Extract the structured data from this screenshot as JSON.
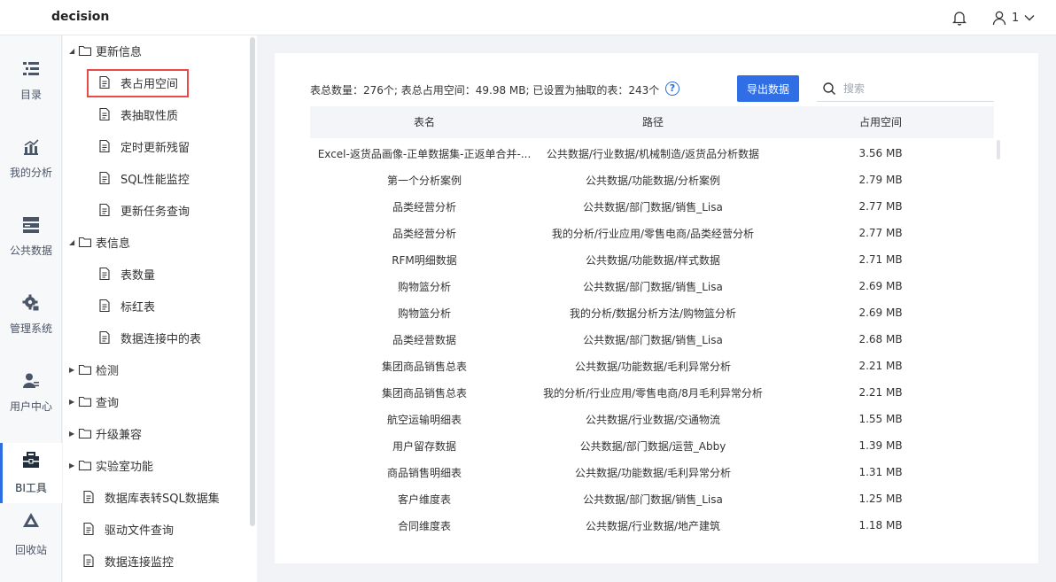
{
  "app": {
    "title": "decision",
    "user": "1"
  },
  "nav": [
    {
      "label": "目录",
      "icon": "catalog-icon",
      "active": false
    },
    {
      "label": "我的分析",
      "icon": "analysis-icon",
      "active": false
    },
    {
      "label": "公共数据",
      "icon": "public-data-icon",
      "active": false
    },
    {
      "label": "管理系统",
      "icon": "gear-icon",
      "active": false
    },
    {
      "label": "用户中心",
      "icon": "user-center-icon",
      "active": false
    },
    {
      "label": "BI工具",
      "icon": "toolbox-icon",
      "active": true
    },
    {
      "label": "回收站",
      "icon": "recycle-icon",
      "active": false
    }
  ],
  "tree": {
    "update_info": "更新信息",
    "table_space": "表占用空间",
    "extract_props": "表抽取性质",
    "scheduled_residual": "定时更新残留",
    "sql_monitor": "SQL性能监控",
    "update_task_query": "更新任务查询",
    "table_info": "表信息",
    "table_count": "表数量",
    "red_tables": "标红表",
    "tables_in_conn": "数据连接中的表",
    "detect": "检测",
    "query": "查询",
    "upgrade_compat": "升级兼容",
    "lab_features": "实验室功能",
    "db_to_sql": "数据库表转SQL数据集",
    "driver_query": "驱动文件查询",
    "conn_monitor": "数据连接监控"
  },
  "toolbar": {
    "summary": "表总数量：276个; 表总占用空间：49.98 MB; 已设置为抽取的表：243个",
    "help": "?",
    "export_label": "导出数据",
    "search_placeholder": "搜索"
  },
  "table": {
    "headers": [
      "表名",
      "路径",
      "占用空间"
    ],
    "rows": [
      [
        "Excel-返货品画像-正单数据集-正返单合并-...",
        "公共数据/行业数据/机械制造/返货品分析数据",
        "3.56 MB"
      ],
      [
        "第一个分析案例",
        "公共数据/功能数据/分析案例",
        "2.79 MB"
      ],
      [
        "品类经营分析",
        "公共数据/部门数据/销售_Lisa",
        "2.77 MB"
      ],
      [
        "品类经营分析",
        "我的分析/行业应用/零售电商/品类经营分析",
        "2.77 MB"
      ],
      [
        "RFM明细数据",
        "公共数据/功能数据/样式数据",
        "2.71 MB"
      ],
      [
        "购物篮分析",
        "公共数据/部门数据/销售_Lisa",
        "2.69 MB"
      ],
      [
        "购物篮分析",
        "我的分析/数据分析方法/购物篮分析",
        "2.69 MB"
      ],
      [
        "品类经营数据",
        "公共数据/部门数据/销售_Lisa",
        "2.68 MB"
      ],
      [
        "集团商品销售总表",
        "公共数据/功能数据/毛利异常分析",
        "2.21 MB"
      ],
      [
        "集团商品销售总表",
        "我的分析/行业应用/零售电商/8月毛利异常分析",
        "2.21 MB"
      ],
      [
        "航空运输明细表",
        "公共数据/行业数据/交通物流",
        "1.55 MB"
      ],
      [
        "用户留存数据",
        "公共数据/部门数据/运营_Abby",
        "1.39 MB"
      ],
      [
        "商品销售明细表",
        "公共数据/功能数据/毛利异常分析",
        "1.31 MB"
      ],
      [
        "客户维度表",
        "公共数据/部门数据/销售_Lisa",
        "1.25 MB"
      ],
      [
        "合同维度表",
        "公共数据/行业数据/地产建筑",
        "1.18 MB"
      ]
    ]
  },
  "colors": {
    "accent": "#2f6ee4",
    "highlight_border": "#e84a4a"
  }
}
